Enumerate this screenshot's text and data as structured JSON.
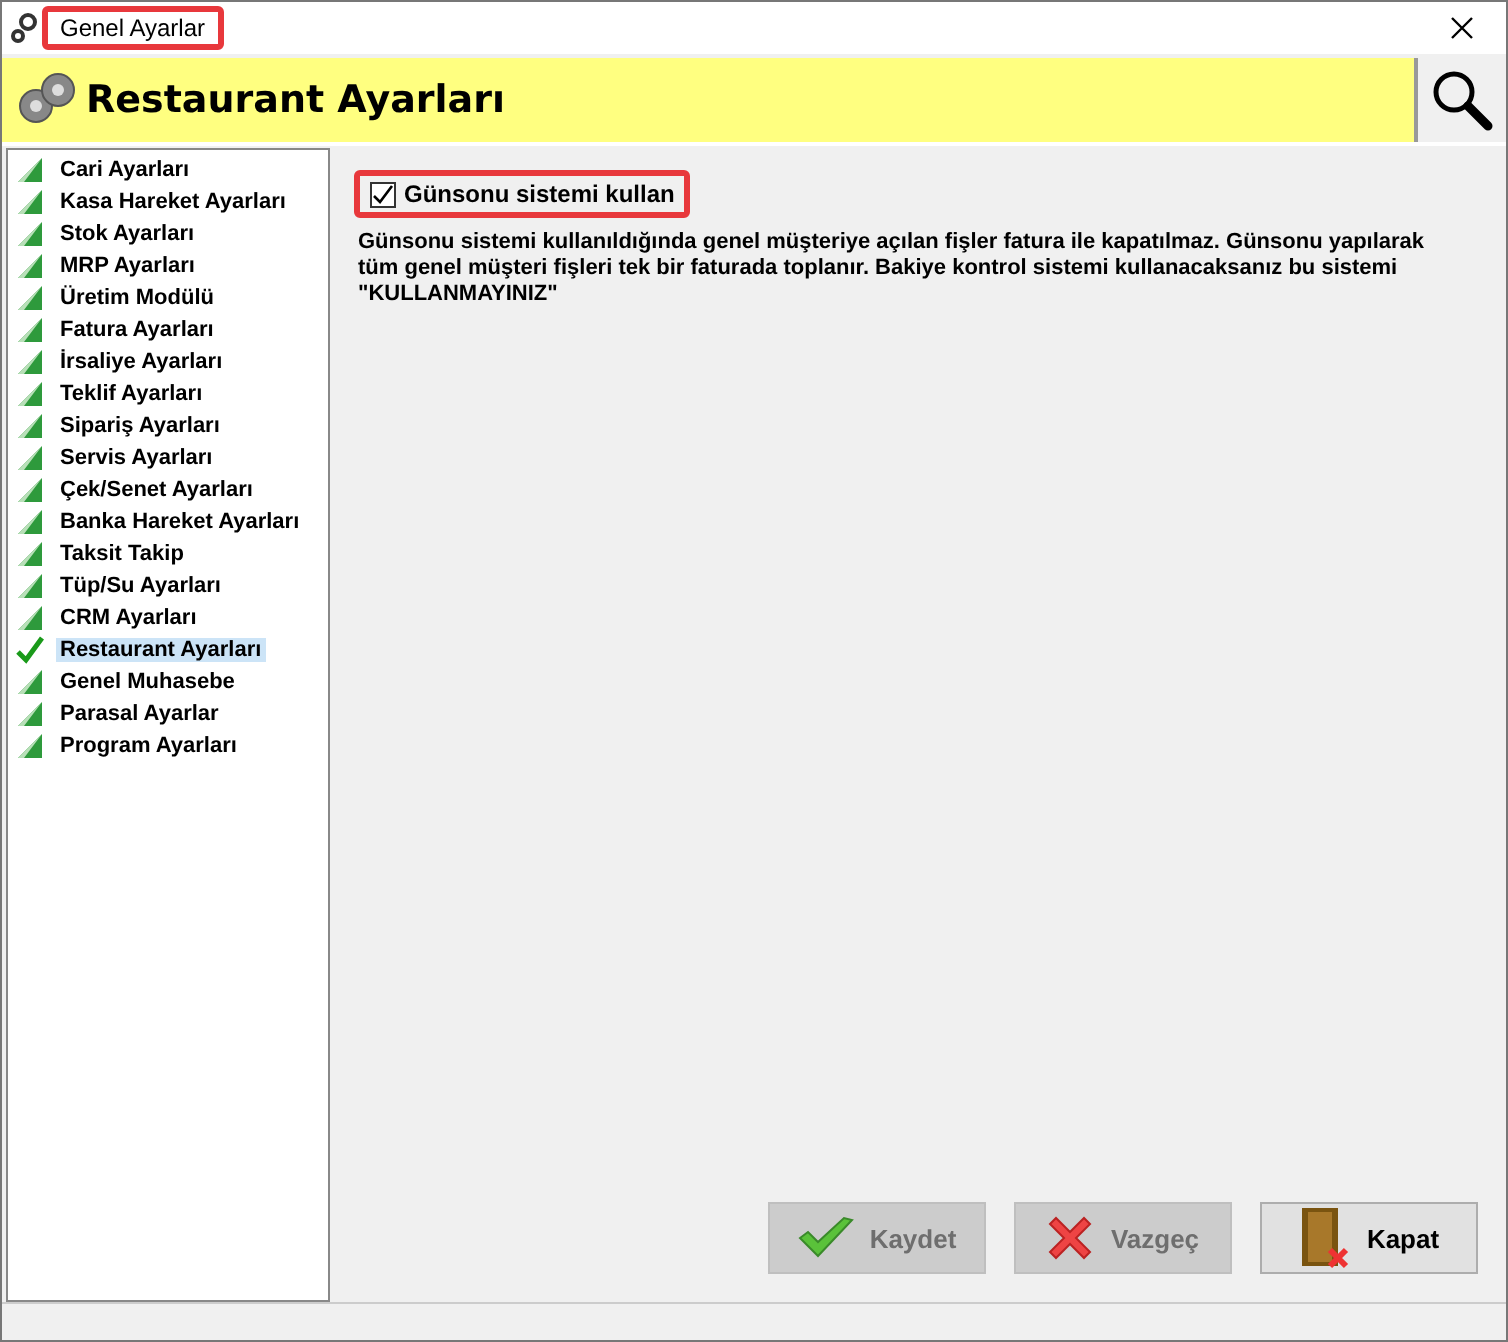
{
  "window": {
    "title": "Genel Ayarlar",
    "title_highlighted": true
  },
  "header": {
    "title": "Restaurant Ayarları"
  },
  "sidebar": {
    "items": [
      {
        "label": "Cari Ayarları",
        "selected": false
      },
      {
        "label": "Kasa Hareket Ayarları",
        "selected": false
      },
      {
        "label": "Stok Ayarları",
        "selected": false
      },
      {
        "label": "MRP Ayarları",
        "selected": false
      },
      {
        "label": "Üretim Modülü",
        "selected": false
      },
      {
        "label": "Fatura Ayarları",
        "selected": false
      },
      {
        "label": "İrsaliye Ayarları",
        "selected": false
      },
      {
        "label": "Teklif Ayarları",
        "selected": false
      },
      {
        "label": "Sipariş Ayarları",
        "selected": false
      },
      {
        "label": "Servis Ayarları",
        "selected": false
      },
      {
        "label": "Çek/Senet Ayarları",
        "selected": false
      },
      {
        "label": "Banka Hareket Ayarları",
        "selected": false
      },
      {
        "label": "Taksit Takip",
        "selected": false
      },
      {
        "label": "Tüp/Su Ayarları",
        "selected": false
      },
      {
        "label": "CRM Ayarları",
        "selected": false
      },
      {
        "label": "Restaurant Ayarları",
        "selected": true
      },
      {
        "label": "Genel Muhasebe",
        "selected": false
      },
      {
        "label": "Parasal Ayarlar",
        "selected": false
      },
      {
        "label": "Program Ayarları",
        "selected": false
      }
    ]
  },
  "option": {
    "label": "Günsonu sistemi kullan",
    "checked": true,
    "highlighted": true,
    "description": "Günsonu sistemi kullanıldığında genel müşteriye açılan fişler fatura ile kapatılmaz. Günsonu yapılarak tüm genel müşteri fişleri tek bir faturada toplanır. Bakiye kontrol sistemi kullanacaksanız bu sistemi \"KULLANMAYINIZ\""
  },
  "buttons": [
    {
      "label": "Kaydet",
      "kind": "save",
      "disabled": true
    },
    {
      "label": "Vazgeç",
      "kind": "cancel",
      "disabled": true
    },
    {
      "label": "Kapat",
      "kind": "close",
      "disabled": false
    }
  ]
}
